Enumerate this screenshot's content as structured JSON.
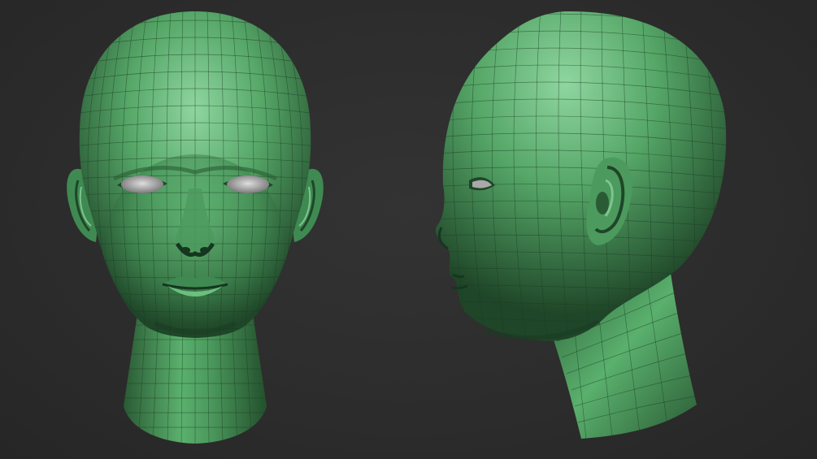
{
  "scene": {
    "background_color": "#2e2e2e",
    "model_color": "#4e9a5e",
    "highlight_color": "#8fd6a0",
    "shadow_color": "#1f4628",
    "eye_color": "#a9a9a9",
    "wireframe_color": "#1c3a22"
  },
  "views": [
    {
      "name": "front",
      "icon": "head-front-icon"
    },
    {
      "name": "side",
      "icon": "head-profile-icon"
    }
  ]
}
